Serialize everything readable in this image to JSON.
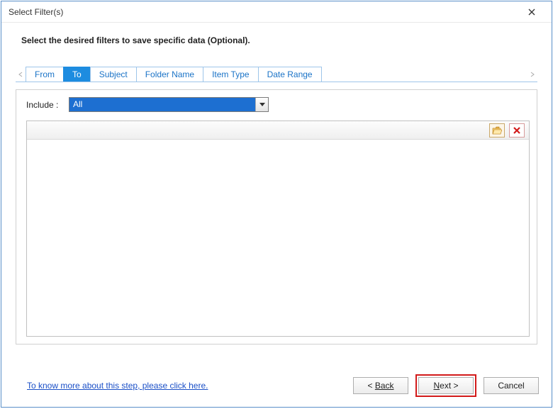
{
  "titlebar": {
    "title": "Select Filter(s)"
  },
  "instruction": "Select the desired filters to save specific data (Optional).",
  "tabs": [
    {
      "label": "From",
      "active": false
    },
    {
      "label": "To",
      "active": true
    },
    {
      "label": "Subject",
      "active": false
    },
    {
      "label": "Folder Name",
      "active": false
    },
    {
      "label": "Item Type",
      "active": false
    },
    {
      "label": "Date Range",
      "active": false
    }
  ],
  "include": {
    "label": "Include :",
    "value": "All"
  },
  "footer": {
    "help_link": "To know more about this step, please click here.",
    "back": "Back",
    "next": "Next >",
    "cancel": "Cancel"
  }
}
